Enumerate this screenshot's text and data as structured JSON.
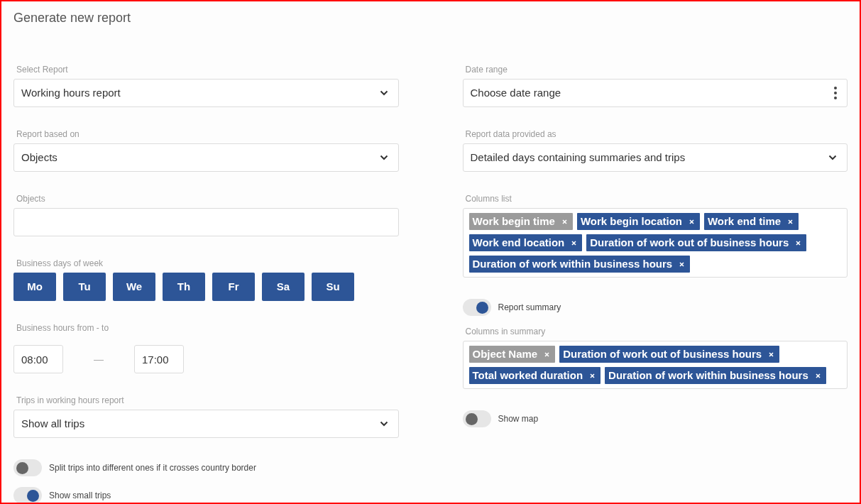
{
  "title": "Generate new report",
  "left": {
    "select_report": {
      "label": "Select Report",
      "value": "Working hours report"
    },
    "report_based_on": {
      "label": "Report based on",
      "value": "Objects"
    },
    "objects": {
      "label": "Objects"
    },
    "business_days": {
      "label": "Business days of week",
      "days": [
        {
          "label": "Mo",
          "selected": true
        },
        {
          "label": "Tu",
          "selected": true
        },
        {
          "label": "We",
          "selected": true
        },
        {
          "label": "Th",
          "selected": true
        },
        {
          "label": "Fr",
          "selected": true
        },
        {
          "label": "Sa",
          "selected": true
        },
        {
          "label": "Su",
          "selected": true
        }
      ]
    },
    "business_hours": {
      "label": "Business hours from - to",
      "from": "08:00",
      "separator": "—",
      "to": "17:00"
    },
    "trips": {
      "label": "Trips in working hours report",
      "value": "Show all trips"
    },
    "toggles": [
      {
        "label": "Split trips into different ones if it crosses country border",
        "on": false
      },
      {
        "label": "Show small trips",
        "on": true
      }
    ]
  },
  "right": {
    "date_range": {
      "label": "Date range",
      "value": "Choose date range"
    },
    "data_provided": {
      "label": "Report data provided as",
      "value": "Detailed days containing summaries and trips"
    },
    "columns_list": {
      "label": "Columns list",
      "tags": [
        {
          "label": "Work begin time",
          "disabled": true
        },
        {
          "label": "Work begin location",
          "disabled": false
        },
        {
          "label": "Work end time",
          "disabled": false
        },
        {
          "label": "Work end location",
          "disabled": false
        },
        {
          "label": "Duration of work out of business hours",
          "disabled": false
        },
        {
          "label": "Duration of work within business hours",
          "disabled": false
        }
      ]
    },
    "report_summary": {
      "label": "Report summary",
      "on": true
    },
    "columns_in_summary": {
      "label": "Columns in summary",
      "tags": [
        {
          "label": "Object Name",
          "disabled": true
        },
        {
          "label": "Duration of work out of business hours",
          "disabled": false
        },
        {
          "label": "Total worked duration",
          "disabled": false
        },
        {
          "label": "Duration of work within business hours",
          "disabled": false
        }
      ]
    },
    "show_map": {
      "label": "Show map",
      "on": false
    }
  }
}
